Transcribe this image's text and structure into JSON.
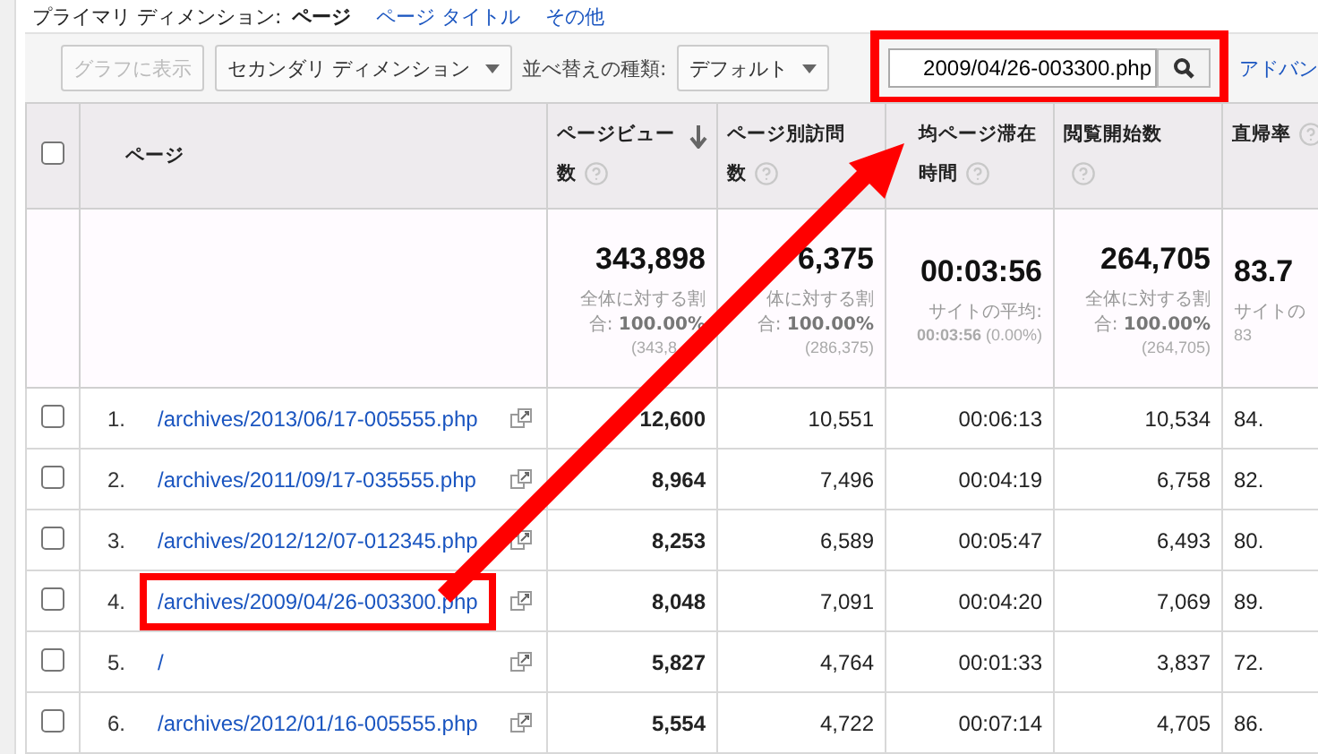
{
  "primary_dimension": {
    "label": "プライマリ ディメンション:",
    "options": [
      {
        "label": "ページ",
        "selected": true
      },
      {
        "label": "ページ タイトル",
        "selected": false
      },
      {
        "label": "その他",
        "selected": false
      }
    ]
  },
  "toolbar": {
    "chart_button": {
      "label": "グラフに表示",
      "disabled": true
    },
    "secondary_dimension": "セカンダリ ディメンション",
    "sort_label": "並べ替えの種類:",
    "sort_value": "デフォルト",
    "search": {
      "value": "2009/04/26-003300.php",
      "highlighted": true
    },
    "advanced_link": "アドバン"
  },
  "table": {
    "select_all": {
      "checked": false
    },
    "columns": [
      {
        "label": "ページ",
        "help": false,
        "sorted": false
      },
      {
        "label": "ページビュー数",
        "help": true,
        "sorted": true
      },
      {
        "label": "ページ別訪問数",
        "help": true,
        "sorted": false
      },
      {
        "label": "均ページ滞在時間",
        "help": true,
        "sorted": false
      },
      {
        "label": "閲覧開始数",
        "help": true,
        "sorted": false
      },
      {
        "label": "直帰率",
        "help": true,
        "sorted": false
      }
    ],
    "summary": [
      {
        "value": "343,898",
        "note": "全体に対する割合: **100.00%**",
        "total": "(343,8"
      },
      {
        "value": "6,375",
        "note": "体に対する割合: **100.00%**",
        "total": "(286,375)"
      },
      {
        "value": "00:03:56",
        "note": "サイトの平均:",
        "total": "**00:03:56** (0.00%)"
      },
      {
        "value": "264,705",
        "note": "全体に対する割合: **100.00%**",
        "total": "(264,705)"
      },
      {
        "value": "83.7",
        "note": "サイトの",
        "total": "83"
      }
    ],
    "rows": [
      {
        "index": "1.",
        "page": "/archives/2013/06/17-005555.php",
        "checked": false,
        "highlighted": false,
        "metrics": [
          "12,600",
          "10,551",
          "00:06:13",
          "10,534",
          "84."
        ]
      },
      {
        "index": "2.",
        "page": "/archives/2011/09/17-035555.php",
        "checked": false,
        "highlighted": false,
        "metrics": [
          "8,964",
          "7,496",
          "00:04:19",
          "6,758",
          "82."
        ]
      },
      {
        "index": "3.",
        "page": "/archives/2012/12/07-012345.php",
        "checked": false,
        "highlighted": false,
        "metrics": [
          "8,253",
          "6,589",
          "00:05:47",
          "6,493",
          "80."
        ]
      },
      {
        "index": "4.",
        "page": "/archives/2009/04/26-003300.php",
        "checked": false,
        "highlighted": true,
        "metrics": [
          "8,048",
          "7,091",
          "00:04:20",
          "7,069",
          "89."
        ]
      },
      {
        "index": "5.",
        "page": "/",
        "checked": false,
        "highlighted": false,
        "metrics": [
          "5,827",
          "4,764",
          "00:01:33",
          "3,837",
          "72."
        ]
      },
      {
        "index": "6.",
        "page": "/archives/2012/01/16-005555.php",
        "checked": false,
        "highlighted": false,
        "metrics": [
          "5,554",
          "4,722",
          "00:07:14",
          "4,705",
          "86."
        ]
      }
    ]
  }
}
